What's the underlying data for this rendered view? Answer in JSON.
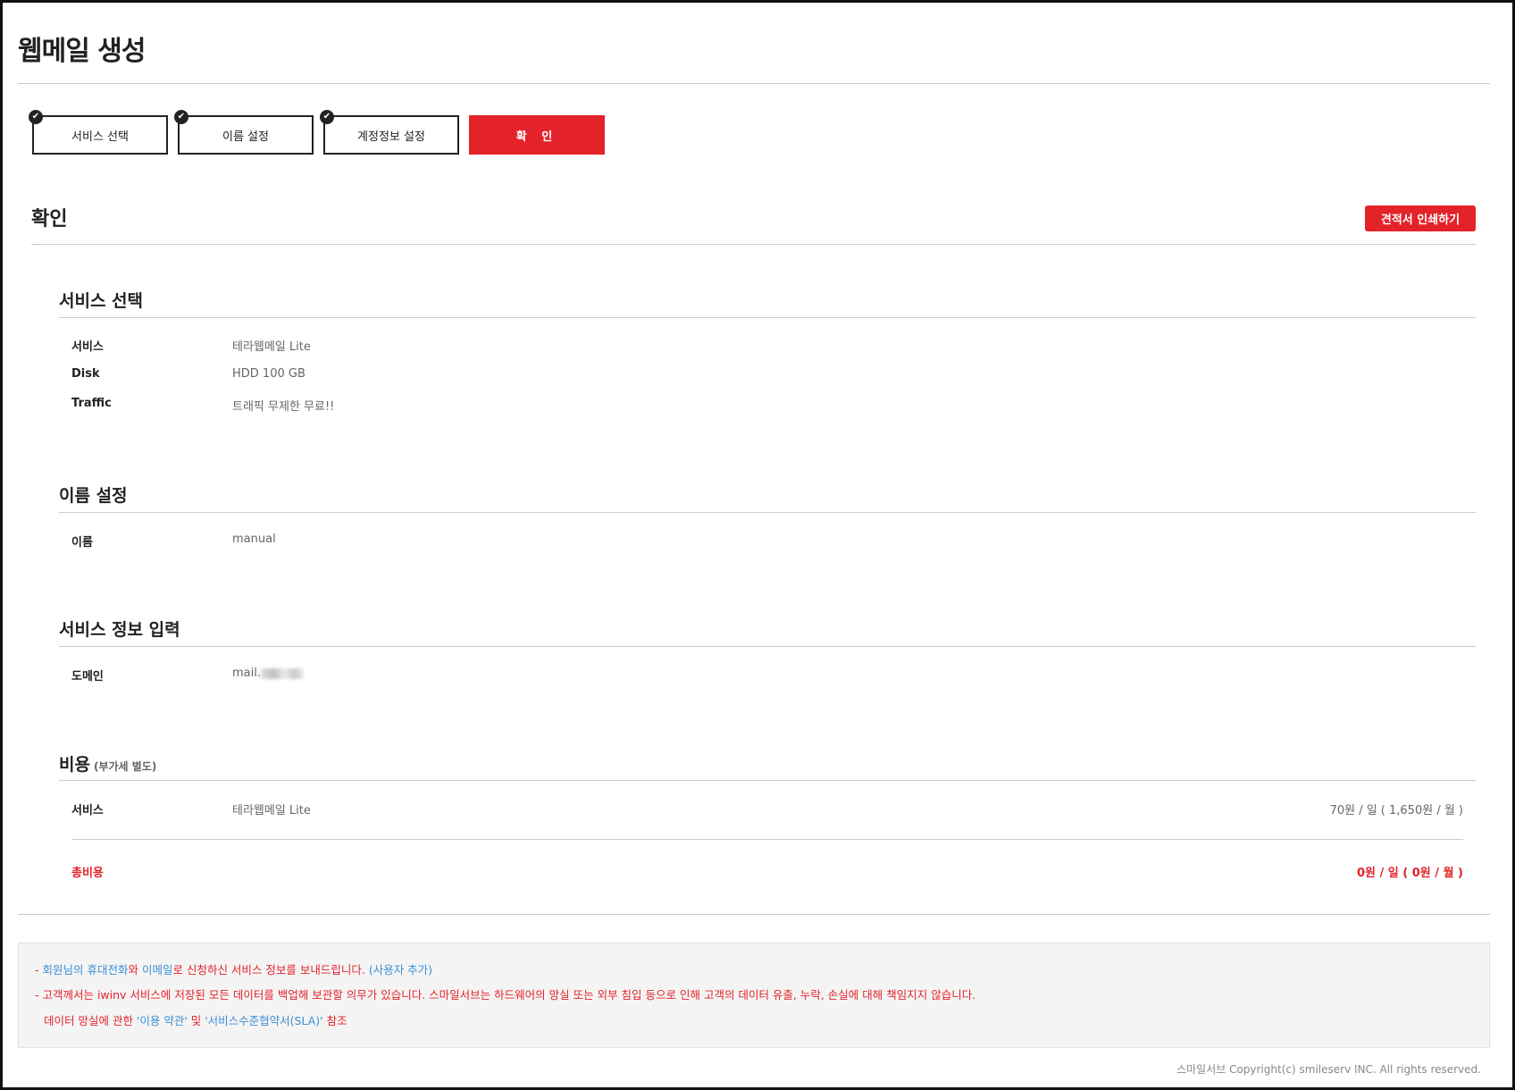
{
  "page": {
    "title": "웹메일 생성"
  },
  "steps": [
    {
      "label": "서비스 선택",
      "done": true
    },
    {
      "label": "이름 설정",
      "done": true
    },
    {
      "label": "계정정보 설정",
      "done": true
    },
    {
      "label": "확 인",
      "done": false,
      "active": true
    }
  ],
  "confirm": {
    "title": "확인",
    "print_label": "견적서 인쇄하기"
  },
  "service_section": {
    "title": "서비스 선택",
    "rows": [
      {
        "label": "서비스",
        "value": "테라웹메일 Lite"
      },
      {
        "label": "Disk",
        "value": "HDD 100 GB"
      },
      {
        "label": "Traffic",
        "value": "트래픽 무제한 무료!!"
      }
    ]
  },
  "name_section": {
    "title": "이름 설정",
    "rows": [
      {
        "label": "이름",
        "value": "manual"
      }
    ]
  },
  "info_section": {
    "title": "서비스 정보 입력",
    "rows": [
      {
        "label": "도메인",
        "value": "mail."
      }
    ]
  },
  "cost_section": {
    "title": "비용",
    "subtitle": "(부가세 별도)",
    "service_label": "서비스",
    "service_value": "테라웹메일 Lite",
    "service_price": "70원 / 일 ( 1,650원 / 월 )",
    "total_label": "총비용",
    "total_price": "0원 / 일 ( 0원 / 월 )"
  },
  "notice": {
    "line1_a": "- ",
    "line1_link1": "회원님의 휴대전화",
    "line1_b": "와 ",
    "line1_link2": "이메일",
    "line1_c": "로 신청하신 서비스 정보를 보내드립니다. ",
    "line1_link3": "(사용자 추가)",
    "line2": "- 고객께서는 iwinv 서비스에 저장된 모든 데이터를 백업해 보관할 의무가 있습니다. 스마일서브는 하드웨어의 망실 또는 외부 침입 등으로 인해 고객의 데이터 유출, 누락, 손실에 대해 책임지지 않습니다.",
    "line3_a": "데이터 망실에 관한 ",
    "line3_link1": "'이용 약관'",
    "line3_b": " 및 ",
    "line3_link2": "'서비스수준협약서(SLA)'",
    "line3_c": " 참조"
  },
  "footer": {
    "copyright": "스마일서브 Copyright(c) smileserv INC. All rights reserved."
  },
  "colors": {
    "accent": "#e4222a",
    "link": "#3a8fd6"
  }
}
